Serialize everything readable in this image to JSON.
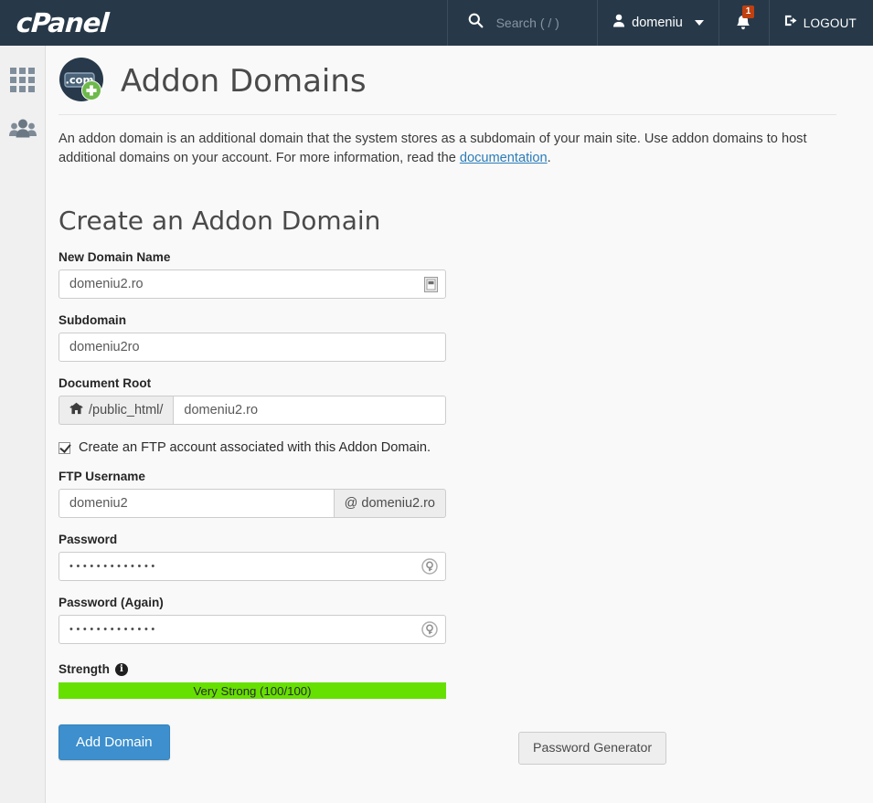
{
  "header": {
    "brand": "cPanel",
    "search_placeholder": "Search ( / )",
    "search_icon": "search-icon",
    "user_name": "domeniu",
    "user_icon": "user-icon",
    "caret_icon": "chevron-down-icon",
    "bell_icon": "bell-icon",
    "notification_count": "1",
    "logout_label": "LOGOUT",
    "logout_icon": "logout-icon",
    "bg_color": "#273949",
    "badge_color": "#c0400f"
  },
  "sidebar": {
    "items": [
      {
        "name": "home-grid",
        "icon": "grid-icon"
      },
      {
        "name": "user-manager",
        "icon": "users-group-icon"
      }
    ]
  },
  "page": {
    "icon": "addon-domains-icon",
    "icon_badge_text": ".com",
    "title": "Addon Domains",
    "intro_part1": "An addon domain is an additional domain that the system stores as a subdomain of your main site. Use addon domains to host additional domains on your account. For more information, read the ",
    "intro_link": "documentation",
    "intro_part2": "."
  },
  "form": {
    "heading": "Create an Addon Domain",
    "new_domain": {
      "label": "New Domain Name",
      "value": "domeniu2.ro",
      "trailing_icon": "form-autofill-icon"
    },
    "subdomain": {
      "label": "Subdomain",
      "value": "domeniu2ro"
    },
    "document_root": {
      "label": "Document Root",
      "prefix_icon": "home-icon",
      "prefix": "/public_html/",
      "value": "domeniu2.ro"
    },
    "ftp_checkbox": {
      "label": "Create an FTP account associated with this Addon Domain.",
      "checked": true
    },
    "ftp_username": {
      "label": "FTP Username",
      "value": "domeniu2",
      "suffix": "@ domeniu2.ro"
    },
    "password": {
      "label": "Password",
      "value_masked": "•••••••••••••",
      "trailing_icon": "password-key-icon"
    },
    "password_again": {
      "label": "Password (Again)",
      "value_masked": "•••••••••••••",
      "trailing_icon": "password-key-icon"
    },
    "strength": {
      "label": "Strength",
      "info_icon": "info-icon",
      "text": "Very Strong (100/100)",
      "score": 100,
      "max_score": 100,
      "percent": 100,
      "bar_color": "#66e000"
    },
    "password_generator_label": "Password Generator",
    "submit_label": "Add Domain",
    "submit_color": "#3d8fcd"
  }
}
